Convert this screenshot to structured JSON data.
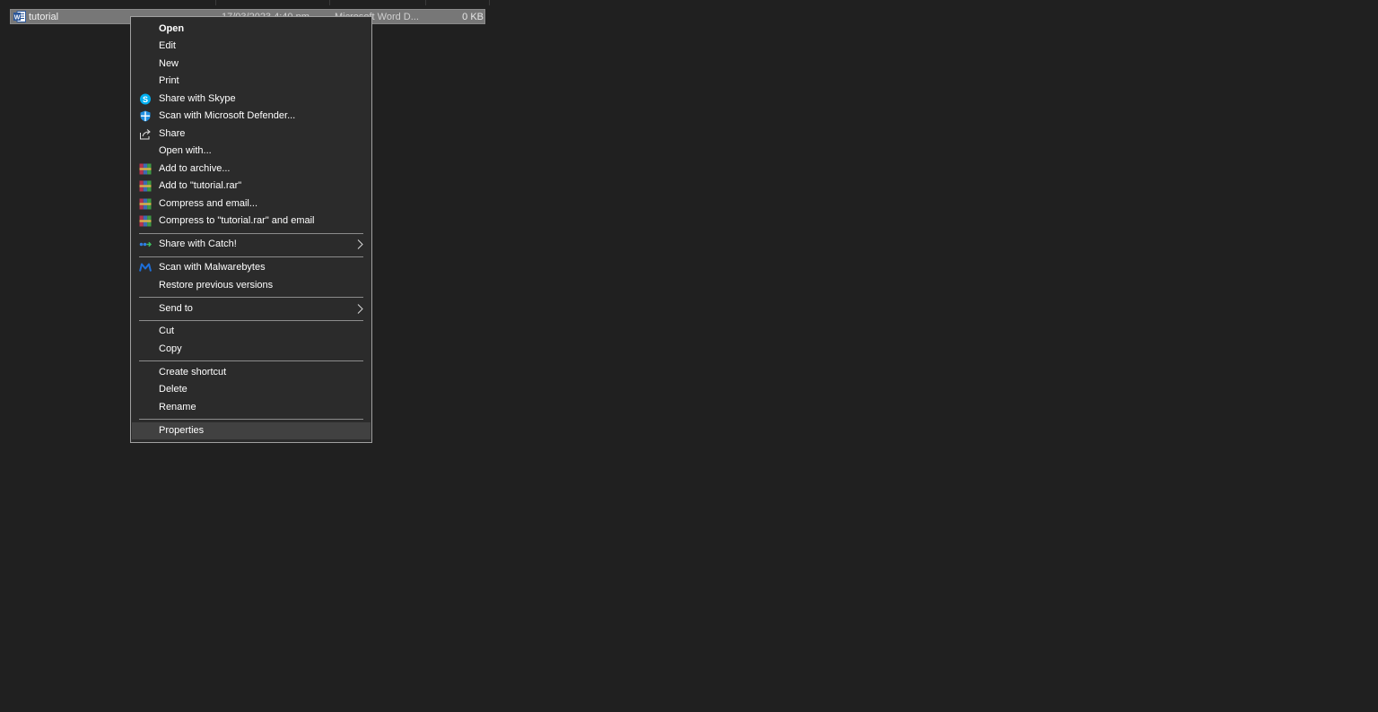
{
  "file": {
    "name": "tutorial",
    "date": "17/03/2023 4:40 pm",
    "type": "Microsoft Word D...",
    "size": "0 KB",
    "icon": "word-document-icon"
  },
  "menu": {
    "open": "Open",
    "edit": "Edit",
    "new": "New",
    "print": "Print",
    "share_skype": "Share with Skype",
    "scan_defender": "Scan with Microsoft Defender...",
    "share": "Share",
    "open_with": "Open with...",
    "add_archive": "Add to archive...",
    "add_rar": "Add to \"tutorial.rar\"",
    "compress_email": "Compress and email...",
    "compress_rar_email": "Compress to \"tutorial.rar\" and email",
    "share_catch": "Share with Catch!",
    "scan_malwarebytes": "Scan with Malwarebytes",
    "restore_versions": "Restore previous versions",
    "send_to": "Send to",
    "cut": "Cut",
    "copy": "Copy",
    "create_shortcut": "Create shortcut",
    "delete": "Delete",
    "rename": "Rename",
    "properties": "Properties"
  },
  "colors": {
    "background": "#202020",
    "menu_background": "#2b2b2b",
    "highlight": "#414141",
    "selection": "#777777"
  }
}
